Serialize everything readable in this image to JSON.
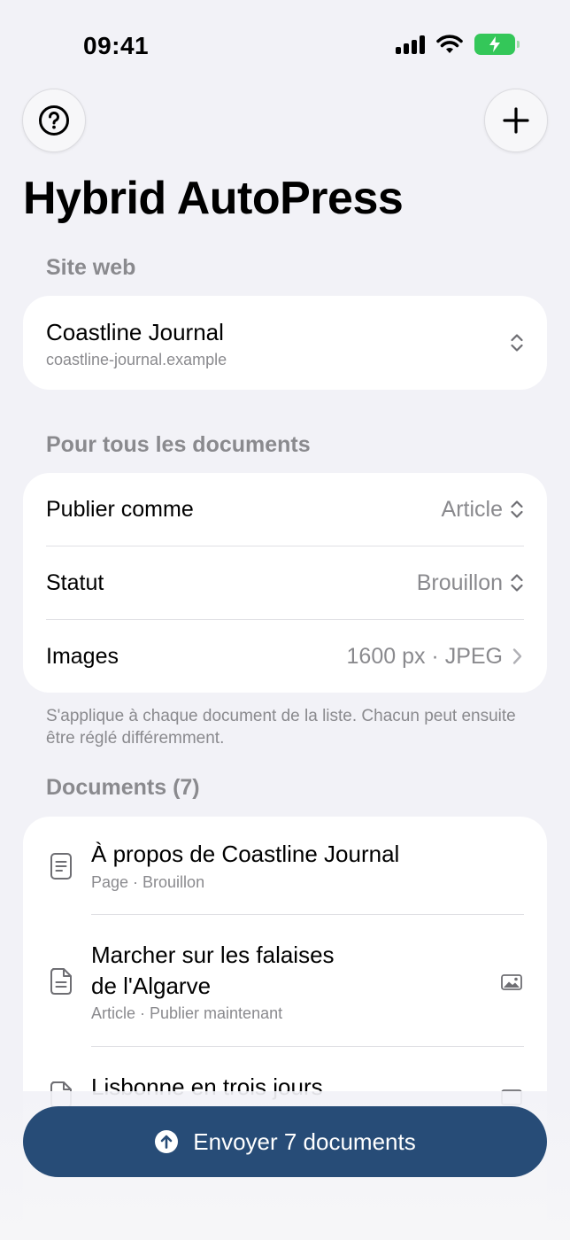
{
  "status_bar": {
    "time": "09:41"
  },
  "app": {
    "title": "Hybrid AutoPress"
  },
  "site_section": {
    "header": "Site web",
    "site": {
      "name": "Coastline Journal",
      "url": "coastline-journal.example"
    }
  },
  "defaults_section": {
    "header": "Pour tous les documents",
    "rows": [
      {
        "label": "Publier comme",
        "value": "Article",
        "accessory": "updown-chevron-icon"
      },
      {
        "label": "Statut",
        "value": "Brouillon",
        "accessory": "updown-chevron-icon"
      },
      {
        "label": "Images",
        "value": "1600 px · JPEG",
        "accessory": "chevron-right-icon"
      }
    ],
    "footnote": "S'applique à chaque document de la liste. Chacun peut ensuite être réglé différemment."
  },
  "documents_section": {
    "header": "Documents (7)",
    "items": [
      {
        "title": "À propos de Coastline Journal",
        "subtitle": "Page · Brouillon",
        "icon": "page-icon"
      },
      {
        "title_line1": "Marcher sur les falaises",
        "title_line2": "de l'Algarve",
        "subtitle": "Article · Publier maintenant",
        "icon": "article-icon",
        "badge": "image-icon"
      },
      {
        "title": "Lisbonne en trois jours",
        "icon": "article-icon",
        "badge": "image-icon"
      }
    ]
  },
  "send_button": {
    "label": "Envoyer 7 documents"
  },
  "colors": {
    "accent": "#274c77",
    "background": "#f2f2f7",
    "secondary_text": "#8a8a8e",
    "battery": "#34c759"
  }
}
